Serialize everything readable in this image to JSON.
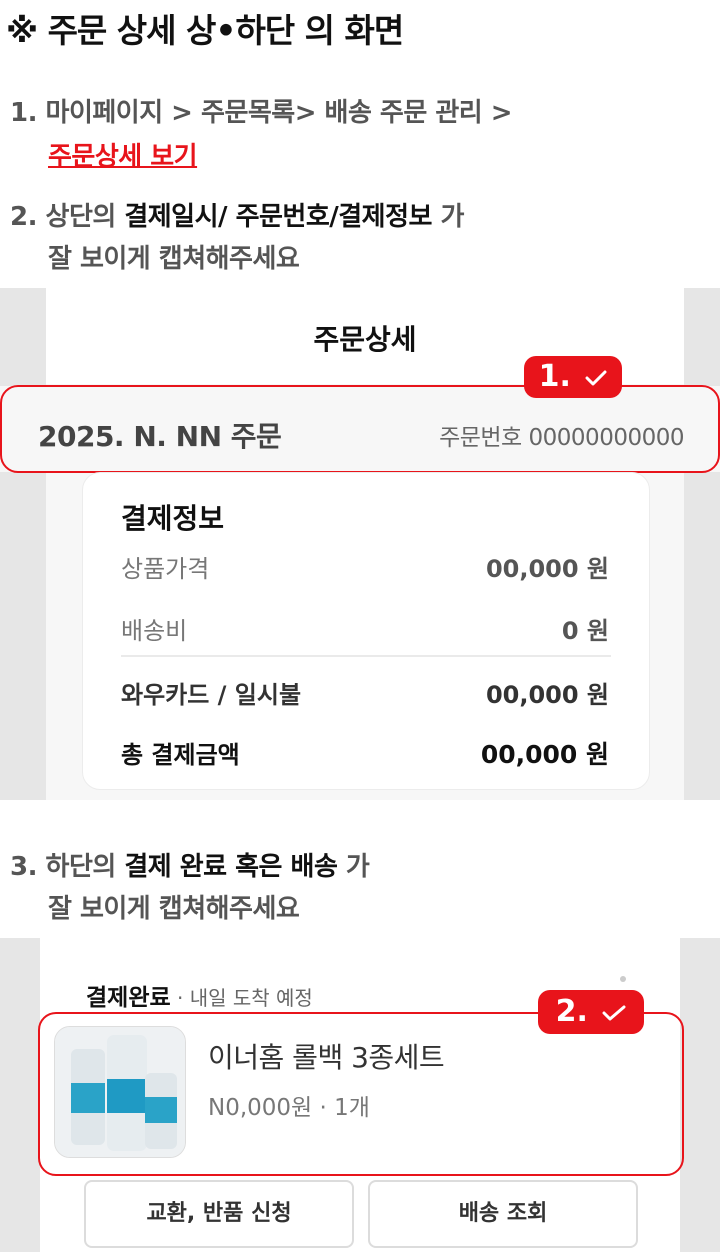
{
  "title": "※ 주문 상세  상•하단 의 화면",
  "instructions": {
    "step1": {
      "num": "1.",
      "text": "마이페이지 > 주문목록> 배송 주문 관리 >",
      "link": "주문상세 보기"
    },
    "step2": {
      "num": "2.",
      "pre": "상단의 ",
      "strong": "결제일시/ 주문번호/결제정보",
      "post": " 가",
      "line2": "잘 보이게 캡쳐해주세요"
    },
    "step3": {
      "num": "3.",
      "pre": "하단의 ",
      "strong": "결제 완료 혹은 배송",
      "post": " 가",
      "line2": "잘 보이게 캡쳐해주세요"
    }
  },
  "top_screenshot": {
    "header_title": "주문상세",
    "badge": "1.",
    "order_date": "2025. N. NN 주문",
    "order_number": "주문번호 00000000000",
    "payment": {
      "title": "결제정보",
      "rows": [
        {
          "label": "상품가격",
          "value": "00,000 원"
        },
        {
          "label": "배송비",
          "value": "0 원"
        },
        {
          "label": "와우카드 / 일시불",
          "value": "00,000 원"
        },
        {
          "label": "총 결제금액",
          "value": "00,000 원"
        }
      ]
    }
  },
  "bottom_screenshot": {
    "status": "결제완료",
    "status_sub": " · 내일 도착 예정",
    "badge": "2.",
    "product_name": "이너홈 롤백 3종세트",
    "product_price": "N0,000원 · 1개",
    "buttons": {
      "exchange": "교환, 반품 신청",
      "track": "배송 조회"
    }
  },
  "colors": {
    "accent": "#e8141b"
  }
}
